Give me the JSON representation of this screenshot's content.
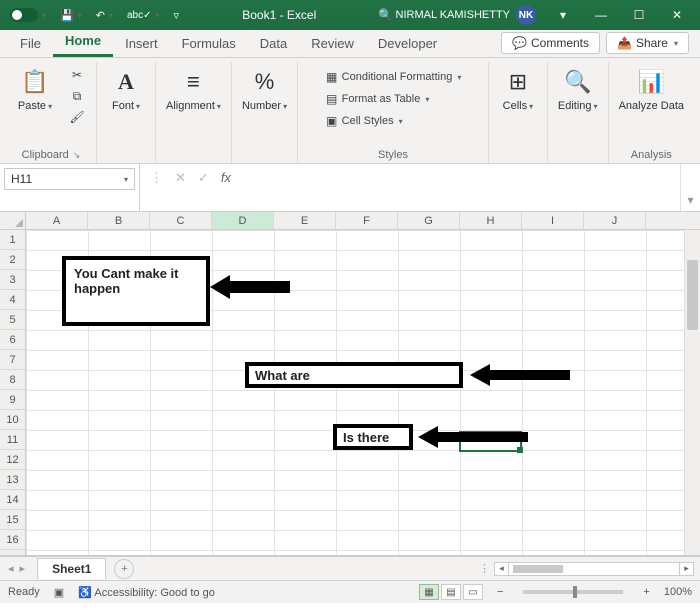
{
  "titlebar": {
    "autosave_label": "",
    "undo_glyph": "↶",
    "redo_glyph": "↷",
    "abc_glyph": "abc✓",
    "title": "Book1 - Excel",
    "search_glyph": "🔍",
    "user_name": "NIRMAL KAMISHETTY",
    "user_initials": "NK",
    "ribbon_toggle": "▾",
    "min_glyph": "—",
    "max_glyph": "☐",
    "close_glyph": "✕"
  },
  "tabs": {
    "file": "File",
    "home": "Home",
    "insert": "Insert",
    "formulas": "Formulas",
    "data": "Data",
    "review": "Review",
    "developer": "Developer",
    "comments": "Comments",
    "share": "Share"
  },
  "ribbon": {
    "paste": "Paste",
    "clipboard": "Clipboard",
    "font": "Font",
    "alignment": "Alignment",
    "number": "Number",
    "cond_fmt": "Conditional Formatting",
    "fmt_table": "Format as Table",
    "cell_styles": "Cell Styles",
    "styles": "Styles",
    "cells": "Cells",
    "editing": "Editing",
    "analyze": "Analyze Data",
    "analysis": "Analysis"
  },
  "namebox": {
    "value": "H11"
  },
  "columns": [
    "A",
    "B",
    "C",
    "D",
    "E",
    "F",
    "G",
    "H",
    "I",
    "J"
  ],
  "rows": [
    "1",
    "2",
    "3",
    "4",
    "5",
    "6",
    "7",
    "8",
    "9",
    "10",
    "11",
    "12",
    "13",
    "14",
    "15",
    "16"
  ],
  "selected_col": "D",
  "shapes": {
    "box1": "You Cant make it happen",
    "box2": "What are",
    "box3": "Is there"
  },
  "sheet": {
    "name": "Sheet1",
    "new": "+"
  },
  "status": {
    "ready": "Ready",
    "accessibility": "Accessibility: Good to go",
    "zoom": "100%"
  }
}
